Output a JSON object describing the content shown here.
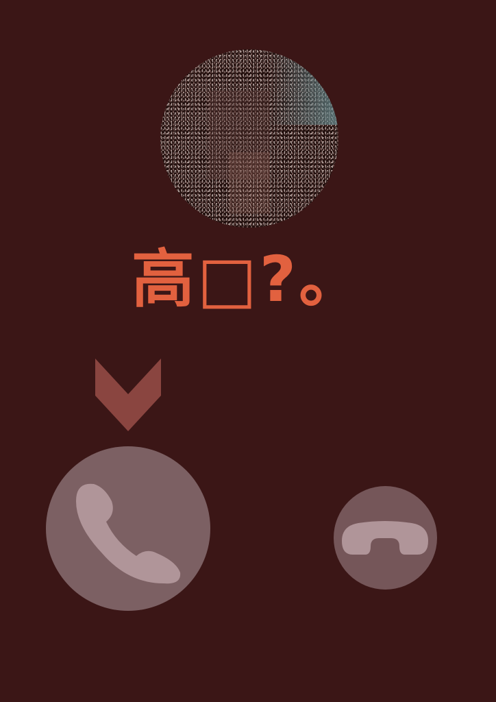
{
  "caller": {
    "name": "高□?。"
  },
  "icons": {
    "avatar": "caller-avatar-photo",
    "swipe_hint": "chevron-down-icon",
    "answer": "phone-handset-icon",
    "decline": "phone-hangup-icon"
  },
  "colors": {
    "background": "#3b1616",
    "name_text": "#e2613f",
    "swipe_hint": "#8a4540",
    "answer_button": "#7c6063",
    "decline_button": "#755659",
    "icon_fill": "#b09599"
  }
}
